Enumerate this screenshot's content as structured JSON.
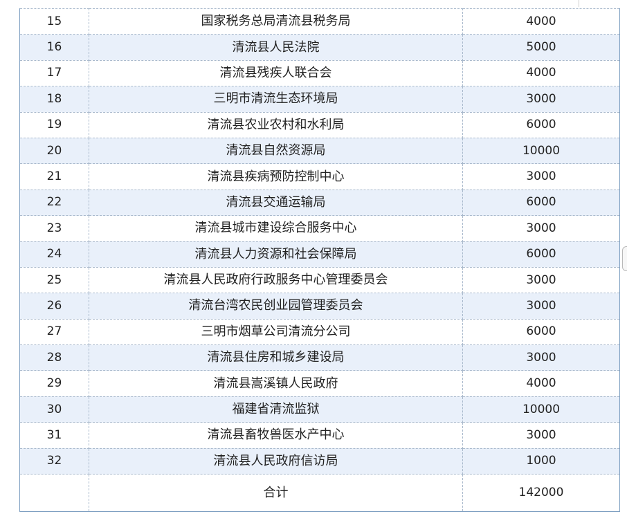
{
  "rows": [
    {
      "no": "15",
      "unit": "国家税务总局清流县税务局",
      "amount": "4000"
    },
    {
      "no": "16",
      "unit": "清流县人民法院",
      "amount": "5000"
    },
    {
      "no": "17",
      "unit": "清流县残疾人联合会",
      "amount": "4000"
    },
    {
      "no": "18",
      "unit": "三明市清流生态环境局",
      "amount": "3000"
    },
    {
      "no": "19",
      "unit": "清流县农业农村和水利局",
      "amount": "6000"
    },
    {
      "no": "20",
      "unit": "清流县自然资源局",
      "amount": "10000"
    },
    {
      "no": "21",
      "unit": "清流县疾病预防控制中心",
      "amount": "3000"
    },
    {
      "no": "22",
      "unit": "清流县交通运输局",
      "amount": "6000"
    },
    {
      "no": "23",
      "unit": "清流县城市建设综合服务中心",
      "amount": "3000"
    },
    {
      "no": "24",
      "unit": "清流县人力资源和社会保障局",
      "amount": "6000"
    },
    {
      "no": "25",
      "unit": "清流县人民政府行政服务中心管理委员会",
      "amount": "3000"
    },
    {
      "no": "26",
      "unit": "清流台湾农民创业园管理委员会",
      "amount": "3000"
    },
    {
      "no": "27",
      "unit": "三明市烟草公司清流分公司",
      "amount": "6000"
    },
    {
      "no": "28",
      "unit": "清流县住房和城乡建设局",
      "amount": "3000"
    },
    {
      "no": "29",
      "unit": "清流县嵩溪镇人民政府",
      "amount": "4000"
    },
    {
      "no": "30",
      "unit": "福建省清流监狱",
      "amount": "10000"
    },
    {
      "no": "31",
      "unit": "清流县畜牧兽医水产中心",
      "amount": "3000"
    },
    {
      "no": "32",
      "unit": "清流县人民政府信访局",
      "amount": "1000"
    }
  ],
  "total": {
    "no": "",
    "label": "合计",
    "amount": "142000"
  }
}
